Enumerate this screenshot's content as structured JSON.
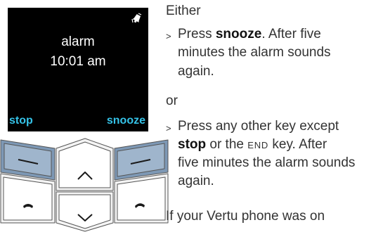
{
  "phone_screen": {
    "icon": "alarm-bell-icon",
    "title": "alarm",
    "time": "10:01 am",
    "left_softkey": "stop",
    "right_softkey": "snooze",
    "softkey_color": "#35c3e8"
  },
  "keypad": {
    "icons": [
      "left-selection-key",
      "up-arrow-icon",
      "right-selection-key",
      "call-icon",
      "down-arrow-icon",
      "end-call-icon"
    ]
  },
  "instructions": {
    "either": "Either",
    "bullet_marker": ">",
    "option1_pre": "Press ",
    "option1_key": "snooze",
    "option1_line1_post": ". After five",
    "option1_line2": "minutes the alarm sounds",
    "option1_line3": "again.",
    "or": "or",
    "option2_line1": "Press any other key except",
    "option2_key": "stop",
    "option2_mid": " or the ",
    "option2_end_key": "END",
    "option2_line2_post": " key. After",
    "option2_line3": "five minutes the alarm sounds",
    "option2_line4": "again.",
    "footer": "If your Vertu phone was on"
  }
}
